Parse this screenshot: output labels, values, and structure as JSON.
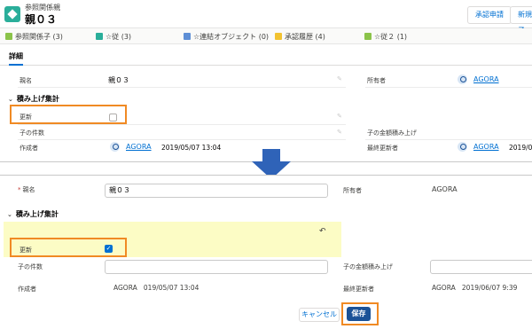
{
  "top_view": {
    "header": {
      "object_type": "参照関係親",
      "record_name": "親０３",
      "buttons": [
        "承認申請",
        "新規子"
      ]
    },
    "related_links": [
      {
        "label": "参照関係子 (3)",
        "color": "#8bc34a"
      },
      {
        "label": "☆従 (3)",
        "color": "#2aae9a"
      },
      {
        "label": "☆連結オブジェクト (0)",
        "color": "#5e8fd6"
      },
      {
        "label": "承認履歴 (4)",
        "color": "#f2c230"
      },
      {
        "label": "☆従２ (1)",
        "color": "#8bc34a"
      }
    ],
    "tab_active": "詳細",
    "fields": {
      "name_label": "親名",
      "name_value": "親０３",
      "owner_label": "所有者",
      "owner_value": "AGORA"
    },
    "section_title": "積み上げ集計",
    "section_fields": {
      "update_label": "更新",
      "update_checked": false,
      "child_count_label": "子の件数",
      "child_sum_label": "子の金額積み上げ",
      "created_by_label": "作成者",
      "created_by_user": "AGORA",
      "created_date": "2019/05/07 13:04",
      "modified_by_label": "最終更新者",
      "modified_by_user": "AGORA",
      "modified_date": "2019/06/"
    }
  },
  "bottom_edit": {
    "name_label": "親名",
    "name_value": "親０３",
    "owner_label": "所有者",
    "owner_value": "AGORA",
    "section_title": "積み上げ集計",
    "update_label": "更新",
    "update_checked": true,
    "update_checkmark": "✓",
    "undo_icon": "↶",
    "child_count_label": "子の件数",
    "child_sum_label": "子の金額積み上げ",
    "created_by_label": "作成者",
    "created_by_value": "AGORA   019/05/07 13:04",
    "modified_by_label": "最終更新者",
    "modified_by_value": "AGORA   2019/06/07 9:39",
    "cancel_label": "キャンセル",
    "save_label": "保存"
  },
  "colors": {
    "highlight": "#f08a24",
    "accent": "#0070d2",
    "arrow": "#2f63b8",
    "edited": "#fcfcc5"
  }
}
